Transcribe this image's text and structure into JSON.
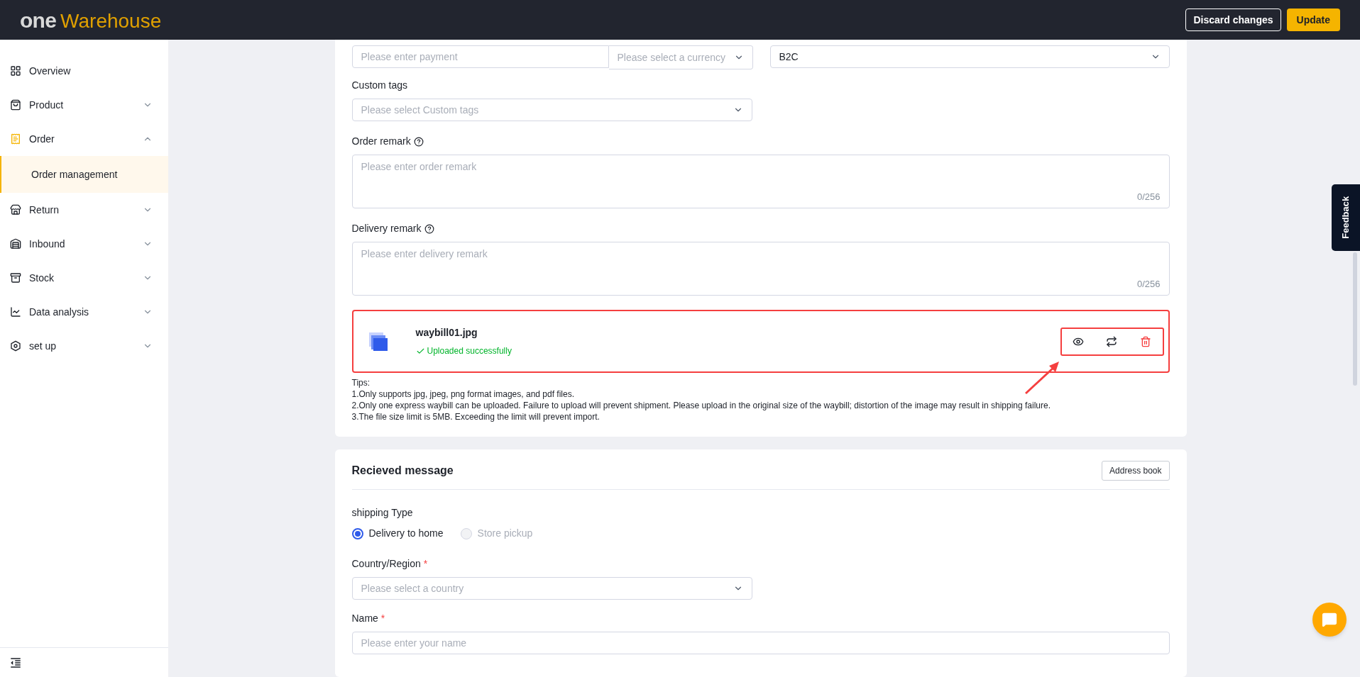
{
  "header": {
    "logo": {
      "part_1": "one",
      "part_2": "Warehouse"
    },
    "buttons": [
      {
        "label": "Discard changes",
        "kind": "outline"
      },
      {
        "label": "Update",
        "kind": "primary"
      }
    ]
  },
  "sidebar": {
    "items": [
      {
        "label": "Overview",
        "kind": "link"
      },
      {
        "label": "Product",
        "kind": "group",
        "expanded": false
      },
      {
        "label": "Order",
        "kind": "group",
        "expanded": true,
        "children": [
          {
            "label": "Order management",
            "selected": true
          }
        ]
      },
      {
        "label": "Return",
        "kind": "group",
        "expanded": false
      },
      {
        "label": "Inbound",
        "kind": "group",
        "expanded": false
      },
      {
        "label": "Stock",
        "kind": "group",
        "expanded": false
      },
      {
        "label": "Data analysis",
        "kind": "group",
        "expanded": false
      },
      {
        "label": "set up",
        "kind": "group",
        "expanded": false
      }
    ]
  },
  "order_form": {
    "payment": {
      "placeholder": "Please enter payment"
    },
    "currency": {
      "placeholder": "Please select a currency"
    },
    "order_type": {
      "value": "B2C"
    },
    "custom_tags": {
      "label": "Custom tags",
      "placeholder": "Please select Custom tags"
    },
    "order_remark": {
      "label": "Order remark",
      "placeholder": "Please enter order remark",
      "counter": "0/256"
    },
    "delivery_remark": {
      "label": "Delivery remark",
      "placeholder": "Please enter delivery remark",
      "counter": "0/256"
    },
    "upload": {
      "file_name": "waybill01.jpg",
      "status": "Uploaded successfully"
    },
    "tips": [
      "Tips:",
      "1.Only supports jpg, jpeg, png format images, and pdf files.",
      "2.Only one express waybill can be uploaded. Failure to upload will prevent shipment. Please upload in the original size of the waybill; distortion of the image may result in shipping failure.",
      "3.The file size limit is 5MB. Exceeding the limit will prevent import."
    ]
  },
  "received_message": {
    "title": "Recieved message",
    "address_book_button": "Address book",
    "shipping_type": {
      "label": "shipping Type",
      "options": [
        {
          "label": "Delivery to home",
          "selected": true,
          "disabled": false
        },
        {
          "label": "Store pickup",
          "selected": false,
          "disabled": true
        }
      ]
    },
    "country": {
      "label": "Country/Region",
      "required_mark": "*",
      "placeholder": "Please select a country"
    },
    "name": {
      "label": "Name",
      "required_mark": "*",
      "placeholder": "Please enter your name"
    }
  },
  "feedback_tab": "Feedback"
}
